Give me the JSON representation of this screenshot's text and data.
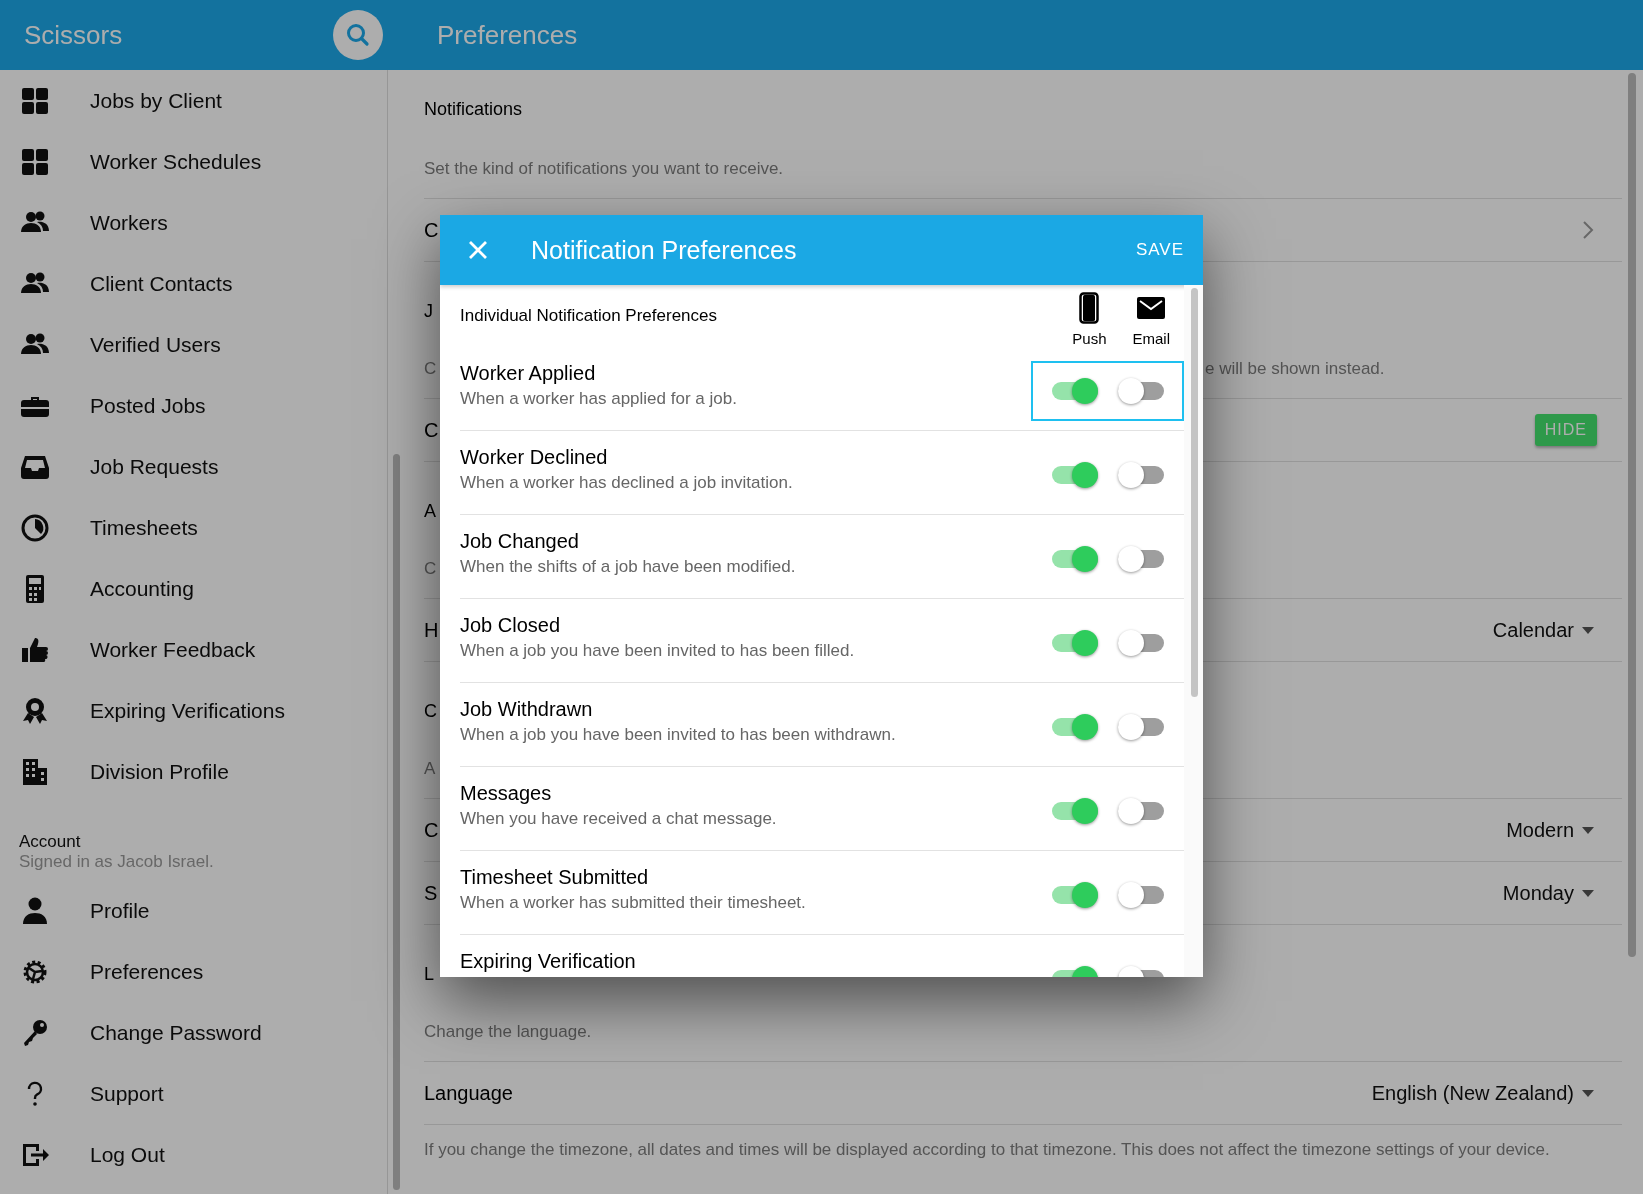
{
  "app": {
    "title": "Scissors"
  },
  "page": {
    "title": "Preferences"
  },
  "sidebar": {
    "items": [
      {
        "label": "Jobs by Client"
      },
      {
        "label": "Worker Schedules"
      },
      {
        "label": "Workers"
      },
      {
        "label": "Client Contacts"
      },
      {
        "label": "Verified Users"
      },
      {
        "label": "Posted Jobs"
      },
      {
        "label": "Job Requests"
      },
      {
        "label": "Timesheets"
      },
      {
        "label": "Accounting"
      },
      {
        "label": "Worker Feedback"
      },
      {
        "label": "Expiring Verifications"
      },
      {
        "label": "Division Profile"
      }
    ],
    "account": {
      "heading": "Account",
      "subtitle": "Signed in as Jacob Israel."
    },
    "account_items": [
      {
        "label": "Profile"
      },
      {
        "label": "Preferences"
      },
      {
        "label": "Change Password"
      },
      {
        "label": "Support"
      },
      {
        "label": "Log Out"
      }
    ]
  },
  "sections": [
    {
      "kind": "heading",
      "text": "Notifications"
    },
    {
      "kind": "description",
      "text": "Set the kind of notifications you want to receive."
    },
    {
      "kind": "link",
      "label": "C"
    },
    {
      "kind": "heading",
      "text": "J"
    },
    {
      "kind": "description",
      "text": "C",
      "tail": "e will be shown instead."
    },
    {
      "kind": "button",
      "label": "C",
      "button": "HIDE"
    },
    {
      "kind": "heading",
      "text": "A"
    },
    {
      "kind": "description",
      "text": "C"
    },
    {
      "kind": "select",
      "label": "H",
      "value": "Calendar"
    },
    {
      "kind": "heading",
      "text": "C"
    },
    {
      "kind": "description",
      "text": "A"
    },
    {
      "kind": "select",
      "label": "C",
      "value": "Modern"
    },
    {
      "kind": "select",
      "label": "S",
      "value": "Monday"
    },
    {
      "kind": "heading",
      "text": "L"
    },
    {
      "kind": "description",
      "text": "Change the language."
    },
    {
      "kind": "select",
      "label": "Language",
      "value": "English (New Zealand)"
    },
    {
      "kind": "paragraph",
      "text": "If you change the timezone, all dates and times will be displayed according to that timezone. This does not affect the timezone settings of your device."
    }
  ],
  "dialog": {
    "title": "Notification Preferences",
    "save": "SAVE",
    "section": "Individual Notification Preferences",
    "channels": [
      {
        "label": "Push"
      },
      {
        "label": "Email"
      }
    ],
    "items": [
      {
        "title": "Worker Applied",
        "description": "When a worker has applied for a job.",
        "push": true,
        "email": false,
        "focused": true
      },
      {
        "title": "Worker Declined",
        "description": "When a worker has declined a job invitation.",
        "push": true,
        "email": false,
        "focused": false
      },
      {
        "title": "Job Changed",
        "description": "When the shifts of a job have been modified.",
        "push": true,
        "email": false,
        "focused": false
      },
      {
        "title": "Job Closed",
        "description": "When a job you have been invited to has been filled.",
        "push": true,
        "email": false,
        "focused": false
      },
      {
        "title": "Job Withdrawn",
        "description": "When a job you have been invited to has been withdrawn.",
        "push": true,
        "email": false,
        "focused": false
      },
      {
        "title": "Messages",
        "description": "When you have received a chat message.",
        "push": true,
        "email": false,
        "focused": false
      },
      {
        "title": "Timesheet Submitted",
        "description": "When a worker has submitted their timesheet.",
        "push": true,
        "email": false,
        "focused": false
      },
      {
        "title": "Expiring Verification",
        "push": true,
        "email": false,
        "focused": false
      }
    ]
  }
}
